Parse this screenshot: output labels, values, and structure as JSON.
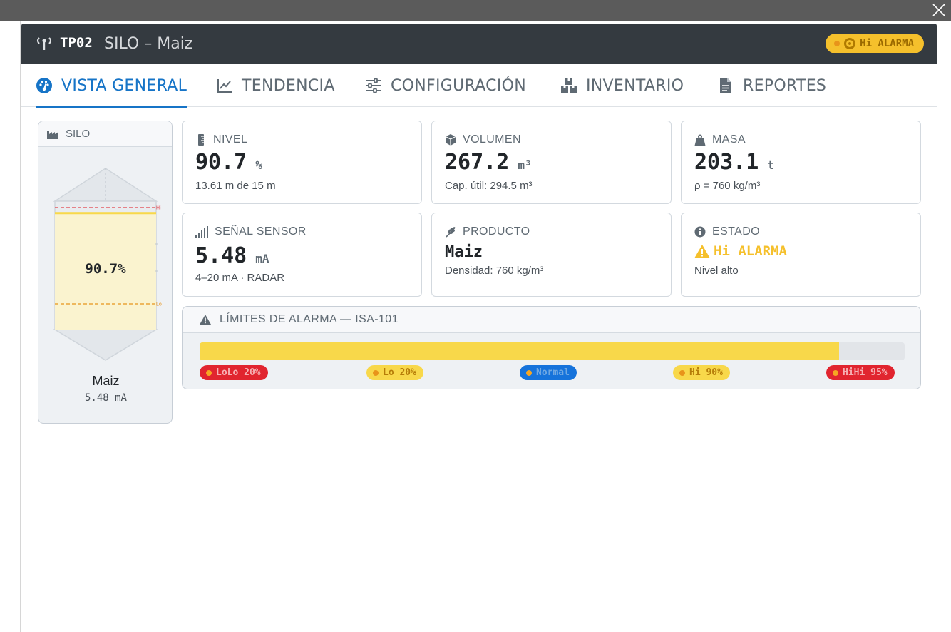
{
  "window": {
    "close_icon": "close-icon"
  },
  "header": {
    "tag": "TP02",
    "title": "SILO – Maiz",
    "alarm_badge": "Hi ALARMA",
    "icon": "antenna-icon"
  },
  "tabs": [
    {
      "label": "VISTA GENERAL",
      "icon": "dashboard-icon",
      "active": true
    },
    {
      "label": "TENDENCIA",
      "icon": "line-chart-icon",
      "active": false
    },
    {
      "label": "CONFIGURACIÓN",
      "icon": "sliders-icon",
      "active": false
    },
    {
      "label": "INVENTARIO",
      "icon": "boxes-icon",
      "active": false
    },
    {
      "label": "REPORTES",
      "icon": "document-icon",
      "active": false
    }
  ],
  "silo": {
    "header": "SILO",
    "level_percent": 90.7,
    "level_text": "90.7%",
    "hi_percent": 95,
    "lo_percent": 20,
    "marker_hi": "Hi",
    "marker_lo": "Lo",
    "product": "Maiz",
    "signal": "5.48 mA",
    "colors": {
      "fill": "#faf3cf",
      "surface": "#f8d84a",
      "hi_line": "#e3424b",
      "lo_line": "#e8941a"
    }
  },
  "cards": {
    "nivel": {
      "label": "NIVEL",
      "value": "90.7",
      "unit": "%",
      "sub": "13.61 m de 15 m"
    },
    "volumen": {
      "label": "VOLUMEN",
      "value": "267.2",
      "unit": "m³",
      "sub": "Cap. útil: 294.5 m³"
    },
    "masa": {
      "label": "MASA",
      "value": "203.1",
      "unit": "t",
      "sub": "ρ = 760 kg/m³"
    },
    "senal": {
      "label": "SEÑAL SENSOR",
      "value": "5.48",
      "unit": "mA",
      "sub": "4–20 mA · RADAR"
    },
    "producto": {
      "label": "PRODUCTO",
      "value": "Maiz",
      "sub": "Densidad: 760 kg/m³"
    },
    "estado": {
      "label": "ESTADO",
      "value": "Hi ALARMA",
      "sub": "Nivel alto"
    }
  },
  "limits": {
    "title": "LÍMITES DE ALARMA — ISA-101",
    "fill_percent": 90.7,
    "pills": [
      {
        "label": "LoLo 20%",
        "kind": "red"
      },
      {
        "label": "Lo 20%",
        "kind": "yellow"
      },
      {
        "label": "Normal",
        "kind": "blue"
      },
      {
        "label": "Hi 90%",
        "kind": "yellow"
      },
      {
        "label": "HiHi 95%",
        "kind": "red"
      }
    ]
  }
}
